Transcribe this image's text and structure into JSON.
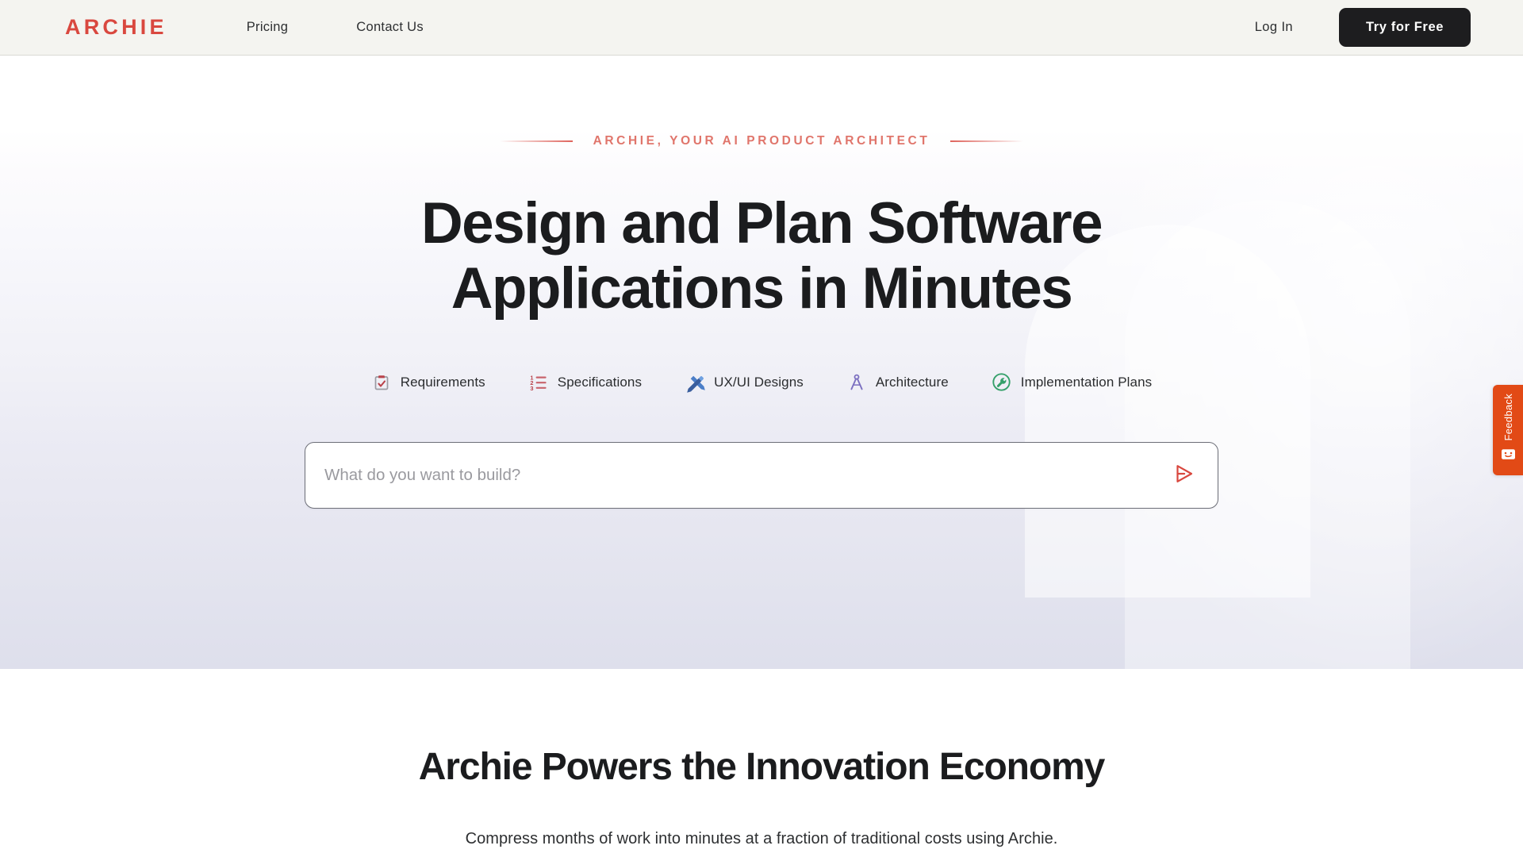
{
  "header": {
    "logo": "ARCHIE",
    "nav": [
      {
        "label": "Pricing",
        "name": "nav-pricing"
      },
      {
        "label": "Contact Us",
        "name": "nav-contact-us"
      }
    ],
    "login_label": "Log In",
    "cta_label": "Try for Free"
  },
  "hero": {
    "eyebrow": "ARCHIE, YOUR AI PRODUCT  ARCHITECT",
    "headline_line_1": "Design and Plan Software",
    "headline_line_2": "Applications in Minutes",
    "features": [
      {
        "label": "Requirements",
        "icon": "clipboard-check-icon",
        "color": "#b9424a"
      },
      {
        "label": "Specifications",
        "icon": "numbered-list-icon",
        "color": "#c25560"
      },
      {
        "label": "UX/UI Designs",
        "icon": "pen-ruler-icon",
        "color": "#3f6fc4"
      },
      {
        "label": "Architecture",
        "icon": "compass-icon",
        "color": "#7b6fc0"
      },
      {
        "label": "Implementation Plans",
        "icon": "wrench-circle-icon",
        "color": "#35a06a"
      }
    ],
    "prompt_placeholder": "What do you want to build?",
    "prompt_value": "",
    "send_icon": "send-arrow-icon"
  },
  "section_two": {
    "title": "Archie Powers the Innovation Economy",
    "subtitle": "Compress months of work into minutes at a fraction of traditional costs using Archie."
  },
  "feedback": {
    "label": "Feedback",
    "icon": "smiley-face-icon"
  },
  "colors": {
    "brand_red": "#d9483f",
    "eyebrow_red": "#e0756b",
    "cta_dark": "#1d1d1f",
    "header_bg": "#f4f4f0",
    "hero_bottom": "#dedfec",
    "feedback_orange": "#e24a16"
  }
}
